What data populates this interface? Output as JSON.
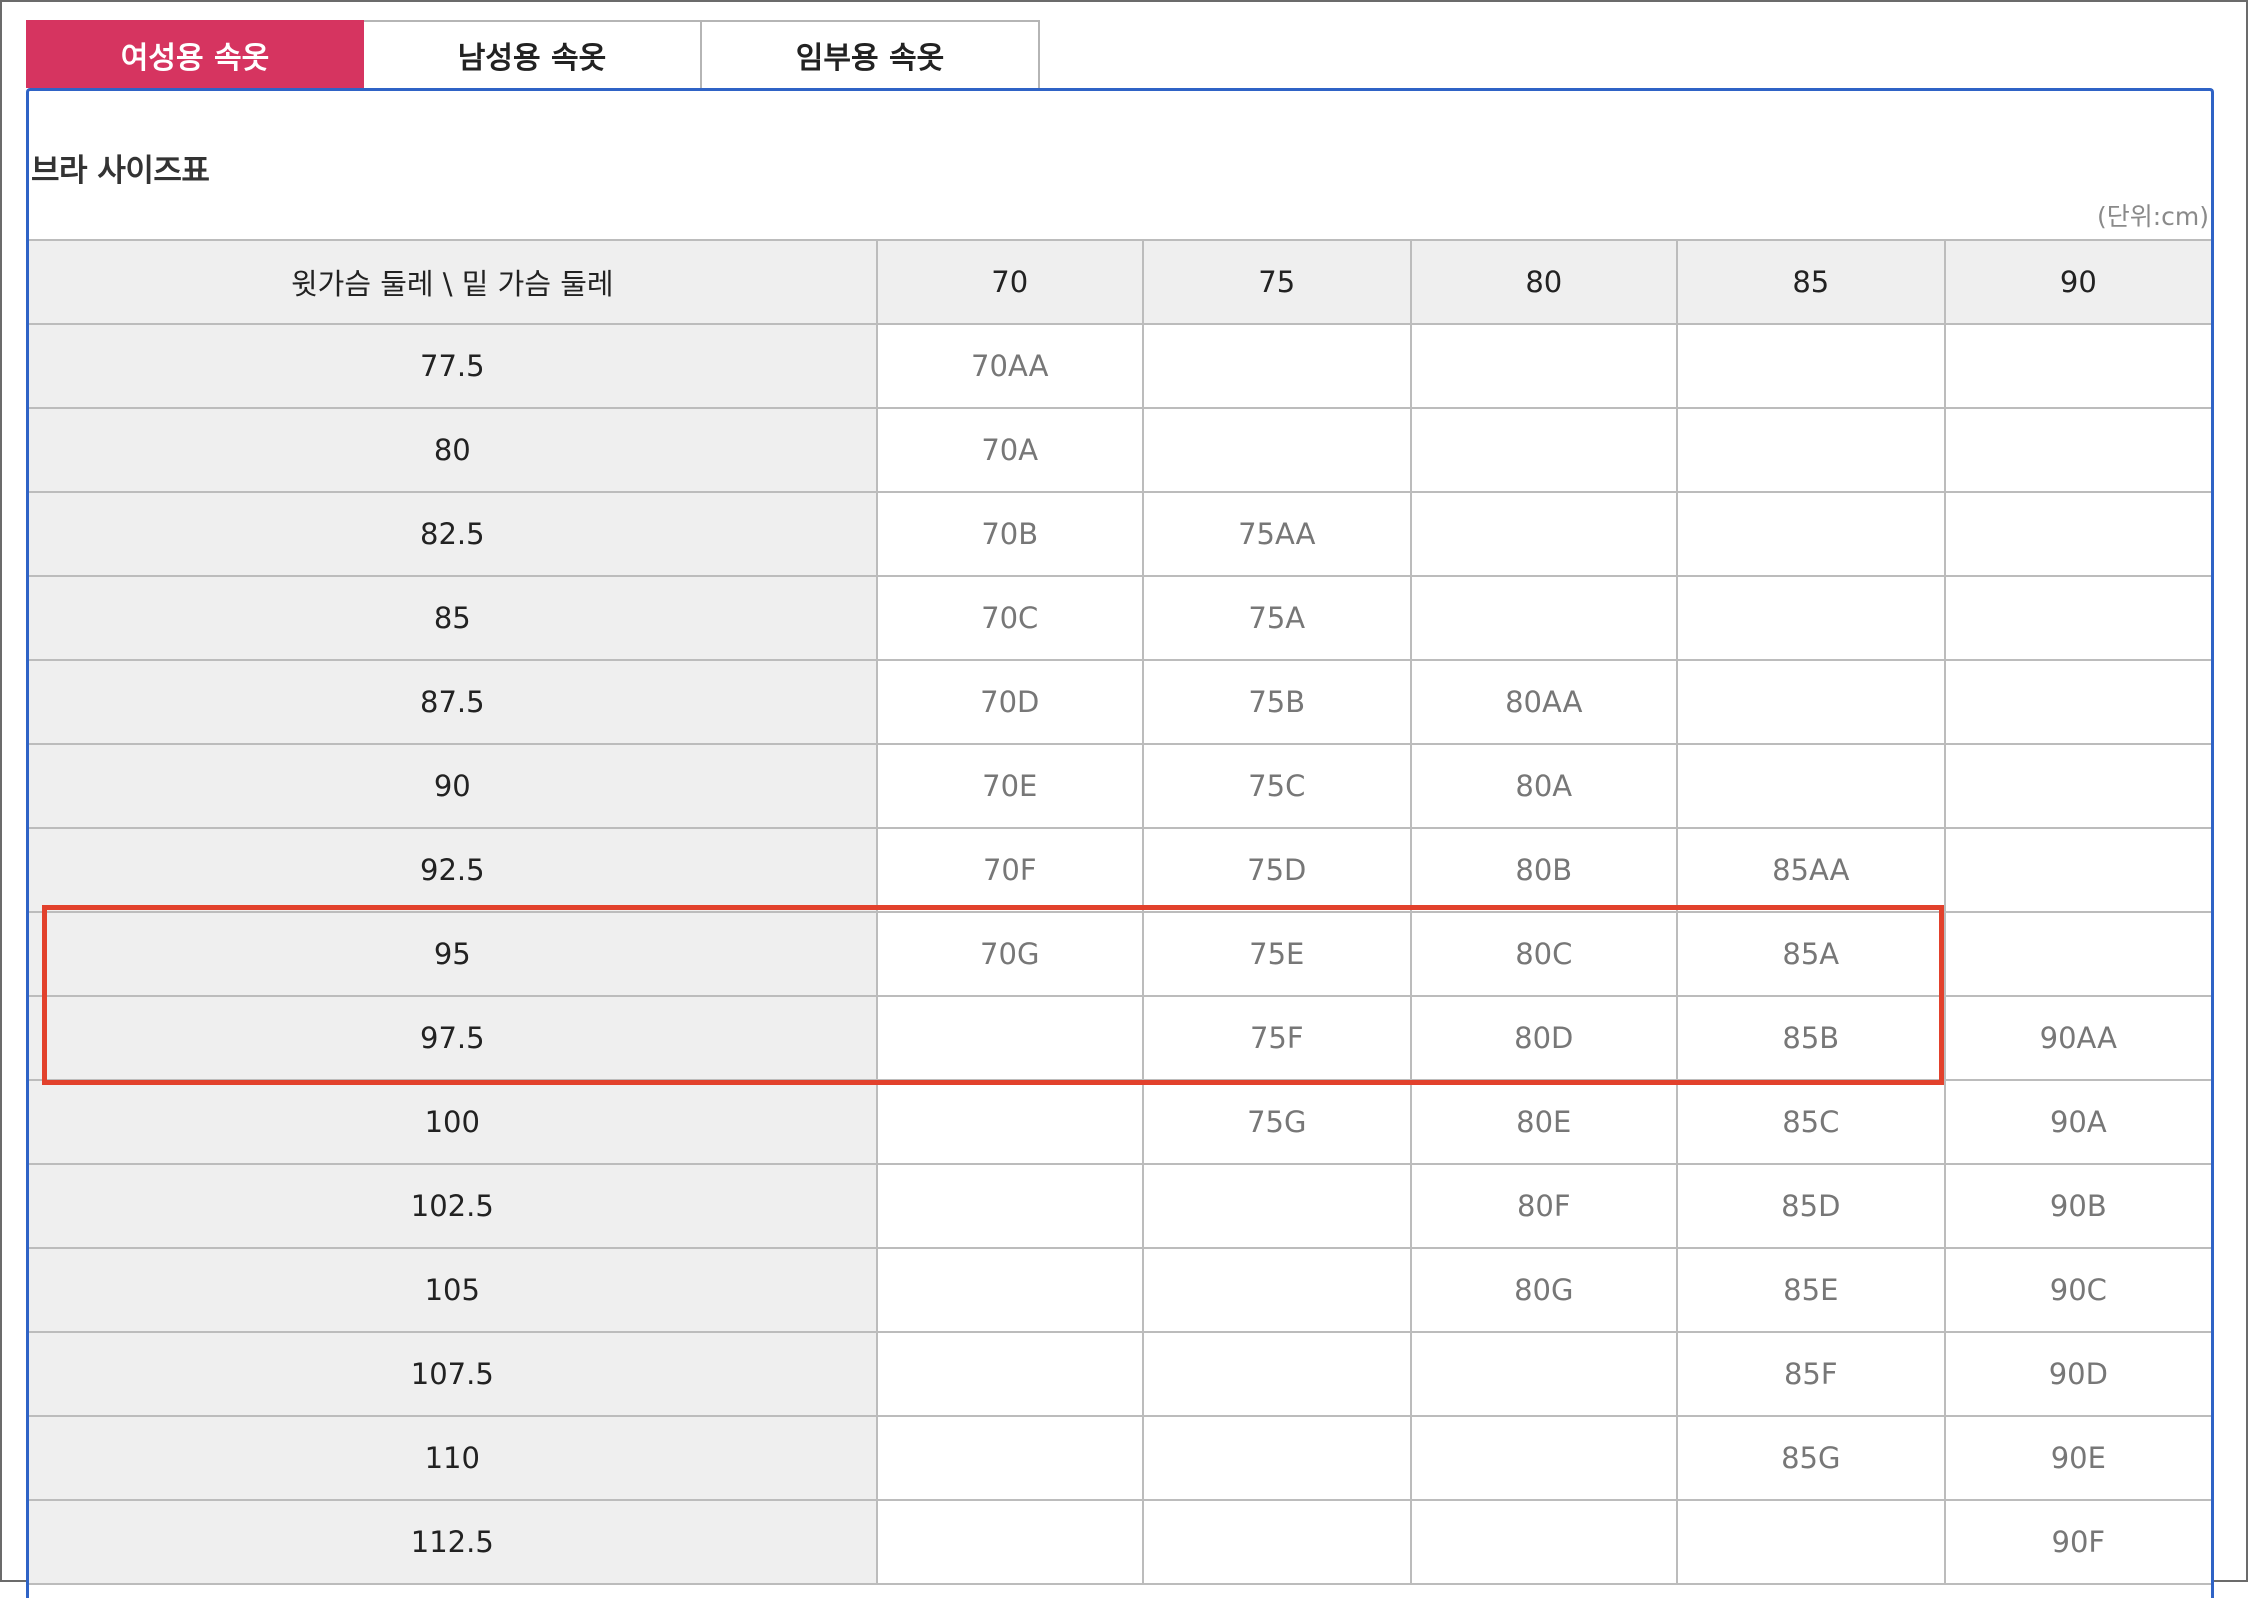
{
  "tabs": [
    {
      "label": "여성용 속옷",
      "active": true
    },
    {
      "label": "남성용 속옷",
      "active": false
    },
    {
      "label": "임부용 속옷",
      "active": false
    }
  ],
  "section_title": "브라 사이즈표",
  "unit_note": "(단위:cm)",
  "table": {
    "corner_header": "윗가슴 둘레 \\ 밑 가슴 둘레",
    "columns": [
      "70",
      "75",
      "80",
      "85",
      "90"
    ],
    "rows": [
      {
        "upper": "77.5",
        "cells": [
          "70AA",
          "",
          "",
          "",
          ""
        ]
      },
      {
        "upper": "80",
        "cells": [
          "70A",
          "",
          "",
          "",
          ""
        ]
      },
      {
        "upper": "82.5",
        "cells": [
          "70B",
          "75AA",
          "",
          "",
          ""
        ]
      },
      {
        "upper": "85",
        "cells": [
          "70C",
          "75A",
          "",
          "",
          ""
        ]
      },
      {
        "upper": "87.5",
        "cells": [
          "70D",
          "75B",
          "80AA",
          "",
          ""
        ]
      },
      {
        "upper": "90",
        "cells": [
          "70E",
          "75C",
          "80A",
          "",
          ""
        ]
      },
      {
        "upper": "92.5",
        "cells": [
          "70F",
          "75D",
          "80B",
          "85AA",
          ""
        ]
      },
      {
        "upper": "95",
        "cells": [
          "70G",
          "75E",
          "80C",
          "85A",
          ""
        ],
        "highlighted": true
      },
      {
        "upper": "97.5",
        "cells": [
          "",
          "75F",
          "80D",
          "85B",
          "90AA"
        ],
        "highlighted": true
      },
      {
        "upper": "100",
        "cells": [
          "",
          "75G",
          "80E",
          "85C",
          "90A"
        ]
      },
      {
        "upper": "102.5",
        "cells": [
          "",
          "",
          "80F",
          "85D",
          "90B"
        ]
      },
      {
        "upper": "105",
        "cells": [
          "",
          "",
          "80G",
          "85E",
          "90C"
        ]
      },
      {
        "upper": "107.5",
        "cells": [
          "",
          "",
          "",
          "85F",
          "90D"
        ]
      },
      {
        "upper": "110",
        "cells": [
          "",
          "",
          "",
          "85G",
          "90E"
        ]
      },
      {
        "upper": "112.5",
        "cells": [
          "",
          "",
          "",
          "",
          "90F"
        ]
      }
    ]
  },
  "colors": {
    "active_tab": "#d63460",
    "panel_border": "#2f63c6",
    "highlight_border": "#e2412c",
    "header_bg": "#efefef",
    "size_text": "#777777"
  }
}
